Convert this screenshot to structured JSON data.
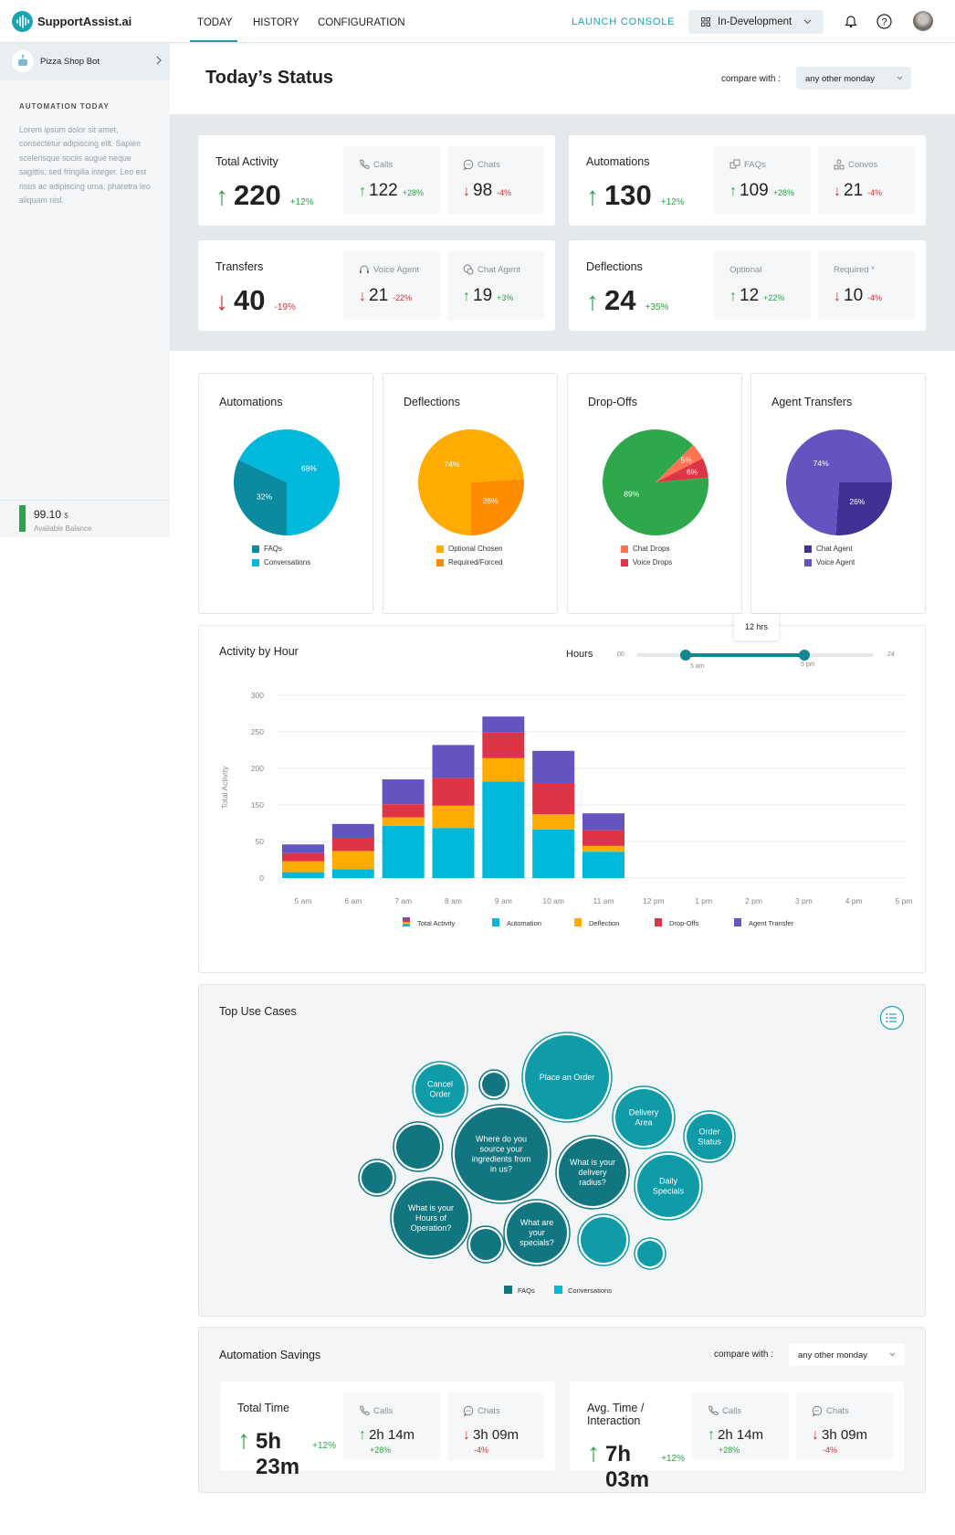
{
  "header": {
    "brand": "SupportAssist.ai",
    "tabs": [
      {
        "label": "TODAY"
      },
      {
        "label": "HISTORY"
      },
      {
        "label": "CONFIGURATION"
      }
    ],
    "launch_console": "LAUNCH CONSOLE",
    "environment": "In-Development"
  },
  "sidebar": {
    "bot_name": "Pizza Shop Bot",
    "section_label": "AUTOMATION TODAY",
    "description": "Lorem ipsum dolor sit amet, consectetur adipiscing elit. Sapien scelerisque sociis augue neque sagittis, sed fringilla integer. Leo est risus ac adipiscing urna, pharetra leo aliquam nisl.",
    "balance": "99.10",
    "currency": "$",
    "balance_label": "Available Balance"
  },
  "page": {
    "title": "Today’s Status",
    "compare_label": "compare with :",
    "compare_value": "any other monday"
  },
  "stats": [
    {
      "title": "Total Activity",
      "value": "220",
      "dir": "up",
      "pct": "+12%",
      "subs": [
        {
          "icon": "phone-icon",
          "label": "Calls",
          "value": "122",
          "dir": "up",
          "pct": "+28%"
        },
        {
          "icon": "chat-bubble-icon",
          "label": "Chats",
          "value": "98",
          "dir": "down",
          "pct": "-4%"
        }
      ]
    },
    {
      "title": "Automations",
      "value": "130",
      "dir": "up",
      "pct": "+12%",
      "subs": [
        {
          "icon": "faq-icon",
          "label": "FAQs",
          "value": "109",
          "dir": "up",
          "pct": "+28%"
        },
        {
          "icon": "convos-icon",
          "label": "Convos",
          "value": "21",
          "dir": "down",
          "pct": "-4%"
        }
      ]
    },
    {
      "title": "Transfers",
      "value": "40",
      "dir": "down",
      "pct": "-19%",
      "subs": [
        {
          "icon": "headset-icon",
          "label": "Voice Agent",
          "value": "21",
          "dir": "down",
          "pct": "-22%"
        },
        {
          "icon": "chat-agent-icon",
          "label": "Chat Agent",
          "value": "19",
          "dir": "up",
          "pct": "+3%"
        }
      ]
    },
    {
      "title": "Deflections",
      "value": "24",
      "dir": "up",
      "pct": "+35%",
      "subs": [
        {
          "icon": "",
          "label": "Optional",
          "value": "12",
          "dir": "up",
          "pct": "+22%"
        },
        {
          "icon": "",
          "label": "Required *",
          "value": "10",
          "dir": "down",
          "pct": "-4%"
        }
      ]
    }
  ],
  "chart_data": [
    {
      "type": "pie",
      "title": "Automations",
      "slices": [
        {
          "label": "FAQs",
          "value": 32,
          "color": "#0b8aa0"
        },
        {
          "label": "Conversations",
          "value": 68,
          "color": "#00b8d9"
        }
      ]
    },
    {
      "type": "pie",
      "title": "Deflections",
      "slices": [
        {
          "label": "Optional Chosen",
          "value": 74,
          "color": "#ffab00"
        },
        {
          "label": "Required/Forced",
          "value": 26,
          "color": "#ff8b00"
        }
      ]
    },
    {
      "type": "pie",
      "title": "Drop-Offs",
      "slices": [
        {
          "label": "Chat Drops",
          "value": 5,
          "color": "#ff7452"
        },
        {
          "label": "Voice Drops",
          "value": 6,
          "color": "#de3546"
        },
        {
          "label": "",
          "value": 89,
          "color": "#2ea84a"
        }
      ]
    },
    {
      "type": "pie",
      "title": "Agent Transfers",
      "slices": [
        {
          "label": "Chat Agent",
          "value": 26,
          "color": "#403294"
        },
        {
          "label": "Voice Agent",
          "value": 74,
          "color": "#6554c0"
        }
      ]
    },
    {
      "type": "bar",
      "stacked": true,
      "title": "Activity by Hour",
      "ylabel": "Total Activity",
      "yticks": [
        0,
        50,
        150,
        200,
        250,
        300
      ],
      "grid": true,
      "legend": "bottom",
      "categories": [
        "5 am",
        "6 am",
        "7 am",
        "8 am",
        "9 am",
        "10 am",
        "11 am",
        "12 pm",
        "1 pm",
        "2 pm",
        "3 pm",
        "4 pm",
        "5 pm"
      ],
      "legend_total": "Total Activity",
      "series": [
        {
          "name": "Automation",
          "color": "#00b8d9",
          "values": [
            8,
            12,
            93,
            87,
            182,
            83,
            36,
            0,
            0,
            0,
            0,
            0,
            0
          ]
        },
        {
          "name": "Deflection",
          "color": "#ffab00",
          "values": [
            15,
            25,
            23,
            61,
            32,
            42,
            8,
            0,
            0,
            0,
            0,
            0,
            0
          ]
        },
        {
          "name": "Drop-Offs",
          "color": "#de3546",
          "values": [
            11,
            23,
            35,
            39,
            35,
            55,
            37,
            0,
            0,
            0,
            0,
            0,
            0
          ]
        },
        {
          "name": "Agent Transfer",
          "color": "#6554c0",
          "values": [
            12,
            38,
            34,
            45,
            22,
            44,
            46,
            0,
            0,
            0,
            0,
            0,
            0
          ]
        }
      ]
    },
    {
      "type": "bubble",
      "title": "Top Use Cases",
      "legend": [
        {
          "label": "FAQs",
          "color": "#127680"
        },
        {
          "label": "Conversations",
          "color": "#00b8d9"
        }
      ],
      "bubbles": [
        {
          "label": "Cancel Order",
          "group": "Conversations"
        },
        {
          "label": "",
          "group": "FAQs"
        },
        {
          "label": "Place an Order",
          "group": "Conversations"
        },
        {
          "label": "Delivery Area",
          "group": "Conversations"
        },
        {
          "label": "Order Status",
          "group": "Conversations"
        },
        {
          "label": "",
          "group": "FAQs"
        },
        {
          "label": "Where do you source your ingredients from in us?",
          "group": "FAQs"
        },
        {
          "label": "What is your delivery radius?",
          "group": "FAQs"
        },
        {
          "label": "Daily Specials",
          "group": "Conversations"
        },
        {
          "label": "",
          "group": "FAQs"
        },
        {
          "label": "What is your Hours of Operation?",
          "group": "FAQs"
        },
        {
          "label": "",
          "group": "FAQs"
        },
        {
          "label": "What are your specials?",
          "group": "FAQs"
        },
        {
          "label": "",
          "group": "Conversations"
        },
        {
          "label": "",
          "group": "Conversations"
        }
      ]
    }
  ],
  "hours_slider": {
    "label": "Hours",
    "min": "00",
    "max": "24",
    "start": "5 am",
    "end": "5 pm",
    "start_value": 5,
    "end_value": 17,
    "tooltip": "12 hrs"
  },
  "savings": {
    "title": "Automation Savings",
    "compare_label": "compare with :",
    "compare_value": "any other monday",
    "cards": [
      {
        "title": "Total Time",
        "value": "5h 23m",
        "dir": "up",
        "pct": "+12%",
        "subs": [
          {
            "icon": "phone-icon",
            "label": "Calls",
            "value": "2h 14m",
            "dir": "up",
            "pct": "+28%"
          },
          {
            "icon": "chat-bubble-icon",
            "label": "Chats",
            "value": "3h 09m",
            "dir": "down",
            "pct": "-4%"
          }
        ]
      },
      {
        "title": "Avg. Time / Interaction",
        "value": "7h 03m",
        "dir": "up",
        "pct": "+12%",
        "subs": [
          {
            "icon": "phone-icon",
            "label": "Calls",
            "value": "2h 14m",
            "dir": "up",
            "pct": "+28%"
          },
          {
            "icon": "chat-bubble-icon",
            "label": "Chats",
            "value": "3h 09m",
            "dir": "down",
            "pct": "-4%"
          }
        ]
      }
    ]
  },
  "colors": {
    "accent": "#1aa3b0",
    "up": "#2aa44a",
    "down": "#d13438"
  }
}
